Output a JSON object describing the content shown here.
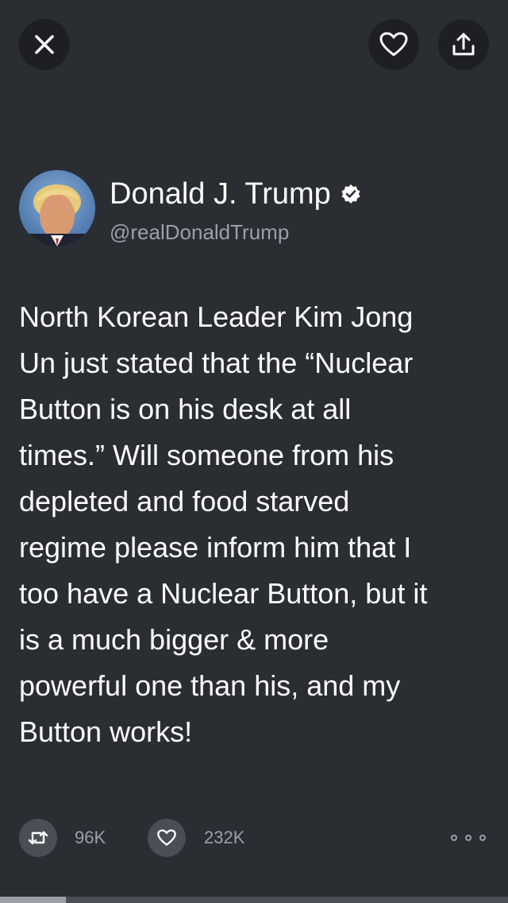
{
  "toolbar": {
    "close_icon": "close-icon",
    "like_icon": "heart-outline-icon",
    "share_icon": "share-upload-icon"
  },
  "author": {
    "name": "Donald J. Trump",
    "handle": "@realDonaldTrump",
    "verified": true
  },
  "tweet": {
    "text": "North Korean Leader Kim Jong\nUn just stated that the “Nuclear\nButton is on his desk at all\ntimes.” Will someone from his\ndepleted and food starved\nregime please inform him that I\ntoo have a Nuclear Button, but it\nis a much bigger & more\npowerful one than his, and my\nButton works!"
  },
  "actions": {
    "retweet_count": "96K",
    "like_count": "232K"
  },
  "progress": {
    "fraction": 0.13
  },
  "colors": {
    "background": "#2a2d32",
    "button_bg": "#1d1f23",
    "muted_text": "#9ba0a8"
  }
}
